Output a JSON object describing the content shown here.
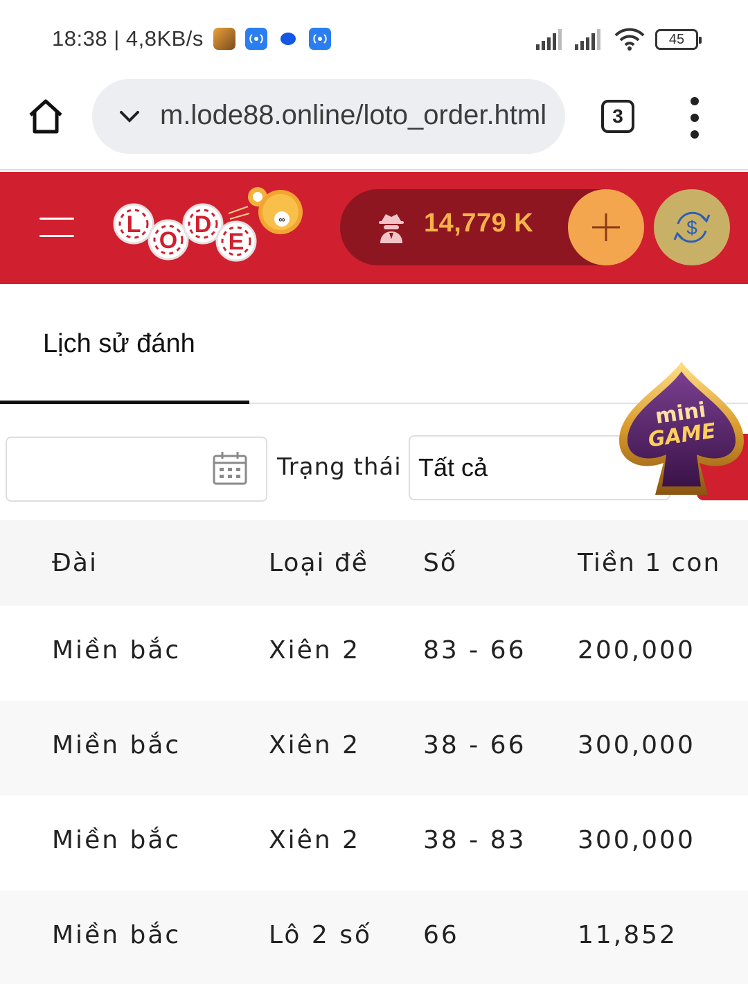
{
  "status_bar": {
    "time_speed": "18:38 | 4,8KB/s",
    "battery": "45"
  },
  "browser": {
    "url": "m.lode88.online/loto_order.html",
    "tab_count": "3"
  },
  "header": {
    "balance": "14,779 K"
  },
  "tabs": {
    "active_label": "Lịch sử đánh"
  },
  "filters": {
    "status_label": "Trạng thái",
    "status_value": "Tất cả"
  },
  "minigame": {
    "line1": "mini",
    "line2": "GAME"
  },
  "table": {
    "headers": [
      "Đài",
      "Loại đề",
      "Số",
      "Tiền 1 con"
    ],
    "rows": [
      [
        "Miền bắc",
        "Xiên 2",
        "83 - 66",
        "200,000"
      ],
      [
        "Miền bắc",
        "Xiên 2",
        "38 - 66",
        "300,000"
      ],
      [
        "Miền bắc",
        "Xiên 2",
        "38 - 83",
        "300,000"
      ],
      [
        "Miền bắc",
        "Lô 2 số",
        "66",
        "11,852"
      ]
    ]
  },
  "colors": {
    "brand_red": "#d01f2e",
    "balance_bg": "#8e1620",
    "balance_text": "#f6b24a",
    "deposit_orange": "#f3a64d",
    "exchange_gold": "#c9b067"
  }
}
